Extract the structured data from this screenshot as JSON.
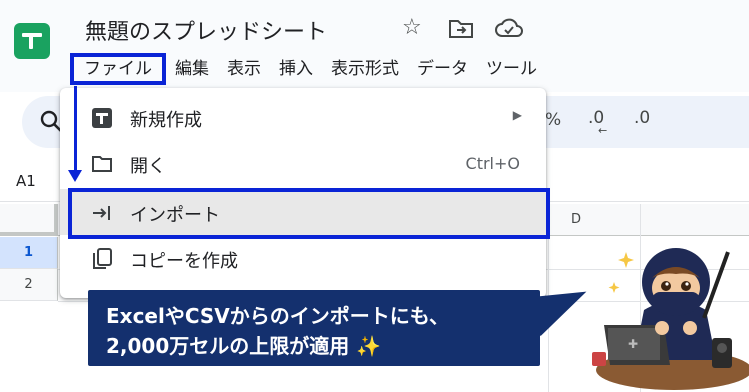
{
  "app": {
    "doc_title": "無題のスプレッドシート",
    "brand_color": "#1aa260"
  },
  "menubar": {
    "items": [
      "ファイル",
      "編集",
      "表示",
      "挿入",
      "表示形式",
      "データ",
      "ツール"
    ]
  },
  "toolbar": {
    "percent": "%",
    "decrease_decimal": ".0",
    "increase_decimal": ".0"
  },
  "namebox": {
    "value": "A1"
  },
  "grid": {
    "columns": [
      "D"
    ],
    "rows": [
      "1",
      "2"
    ]
  },
  "file_menu": {
    "items": [
      {
        "label": "新規作成",
        "icon": "new-sheet-icon",
        "submenu": true
      },
      {
        "label": "開く",
        "icon": "folder-icon",
        "shortcut": "Ctrl+O"
      },
      {
        "label": "インポート",
        "icon": "import-icon",
        "highlighted": true
      },
      {
        "label": "コピーを作成",
        "icon": "copy-icon"
      }
    ]
  },
  "annotation": {
    "accent_color": "#0a24d6",
    "callout_line1": "ExcelやCSVからのインポートにも、",
    "callout_line2": "2,000万セルの上限が適用",
    "callout_color": "#14306e"
  }
}
